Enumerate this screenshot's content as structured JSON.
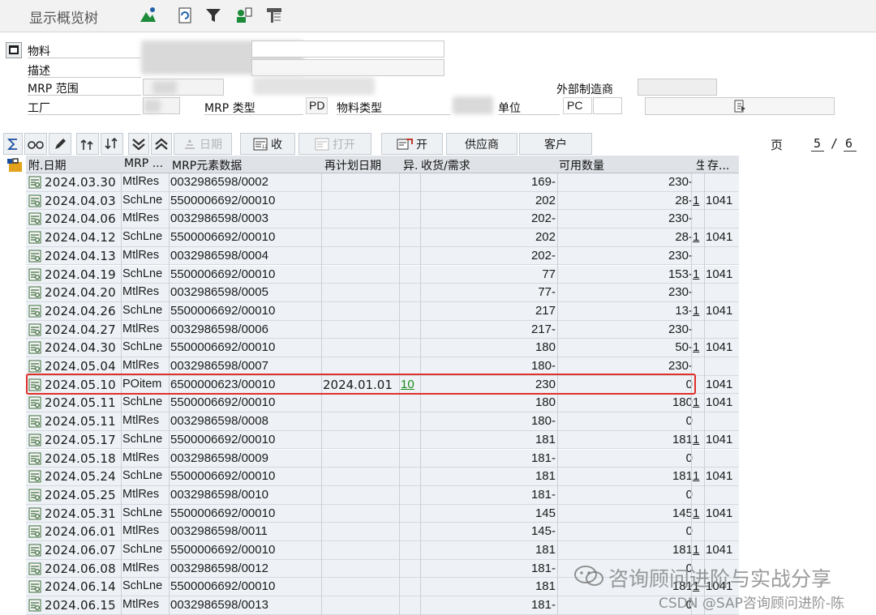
{
  "app": {
    "title": "显示概览树"
  },
  "header": {
    "material_label": "物料",
    "description_label": "描述",
    "mrp_area_label": "MRP 范围",
    "plant_label": "工厂",
    "mrp_type_label": "MRP 类型",
    "mrp_type_value": "PD",
    "material_type_label": "物料类型",
    "unit_label": "单位",
    "unit_value": "PC",
    "external_mfr_label": "外部制造商"
  },
  "toolbar": {
    "date_label": "日期",
    "receipts_label": "收",
    "open_label": "打开",
    "open2_label": "开",
    "vendor_label": "供应商",
    "customer_label": "客户",
    "page_label": "页",
    "page_current": "5",
    "page_sep": "/",
    "page_total": "6"
  },
  "columns": {
    "date": "附.日期",
    "mrp_elem": "MRP ...",
    "mrp_elem_data": "MRP元素数据",
    "reschedule_date": "再计划日期",
    "exception": "异.",
    "rec_req": "收货/需求",
    "available": "可用数量",
    "flag": "生",
    "storage": "存..."
  },
  "rows": [
    {
      "date": "2024.03.30",
      "mrp": "MtlRes",
      "elem": "0032986598/0002",
      "resched": "",
      "exc": "",
      "qty": "169-",
      "avail": "230-",
      "flag": "",
      "store": ""
    },
    {
      "date": "2024.04.03",
      "mrp": "SchLne",
      "elem": "5500006692/00010",
      "resched": "",
      "exc": "",
      "qty": "202",
      "avail": "28-",
      "flag": "1",
      "store": "1041"
    },
    {
      "date": "2024.04.06",
      "mrp": "MtlRes",
      "elem": "0032986598/0003",
      "resched": "",
      "exc": "",
      "qty": "202-",
      "avail": "230-",
      "flag": "",
      "store": ""
    },
    {
      "date": "2024.04.12",
      "mrp": "SchLne",
      "elem": "5500006692/00010",
      "resched": "",
      "exc": "",
      "qty": "202",
      "avail": "28-",
      "flag": "1",
      "store": "1041"
    },
    {
      "date": "2024.04.13",
      "mrp": "MtlRes",
      "elem": "0032986598/0004",
      "resched": "",
      "exc": "",
      "qty": "202-",
      "avail": "230-",
      "flag": "",
      "store": ""
    },
    {
      "date": "2024.04.19",
      "mrp": "SchLne",
      "elem": "5500006692/00010",
      "resched": "",
      "exc": "",
      "qty": "77",
      "avail": "153-",
      "flag": "1",
      "store": "1041"
    },
    {
      "date": "2024.04.20",
      "mrp": "MtlRes",
      "elem": "0032986598/0005",
      "resched": "",
      "exc": "",
      "qty": "77-",
      "avail": "230-",
      "flag": "",
      "store": ""
    },
    {
      "date": "2024.04.26",
      "mrp": "SchLne",
      "elem": "5500006692/00010",
      "resched": "",
      "exc": "",
      "qty": "217",
      "avail": "13-",
      "flag": "1",
      "store": "1041"
    },
    {
      "date": "2024.04.27",
      "mrp": "MtlRes",
      "elem": "0032986598/0006",
      "resched": "",
      "exc": "",
      "qty": "217-",
      "avail": "230-",
      "flag": "",
      "store": ""
    },
    {
      "date": "2024.04.30",
      "mrp": "SchLne",
      "elem": "5500006692/00010",
      "resched": "",
      "exc": "",
      "qty": "180",
      "avail": "50-",
      "flag": "1",
      "store": "1041"
    },
    {
      "date": "2024.05.04",
      "mrp": "MtlRes",
      "elem": "0032986598/0007",
      "resched": "",
      "exc": "",
      "qty": "180-",
      "avail": "230-",
      "flag": "",
      "store": ""
    },
    {
      "date": "2024.05.10",
      "mrp": "POitem",
      "elem": "6500000623/00010",
      "resched": "2024.01.01",
      "exc": "10",
      "qty": "230",
      "avail": "0",
      "flag": "",
      "store": "1041"
    },
    {
      "date": "2024.05.11",
      "mrp": "SchLne",
      "elem": "5500006692/00010",
      "resched": "",
      "exc": "",
      "qty": "180",
      "avail": "180",
      "flag": "1",
      "store": "1041"
    },
    {
      "date": "2024.05.11",
      "mrp": "MtlRes",
      "elem": "0032986598/0008",
      "resched": "",
      "exc": "",
      "qty": "180-",
      "avail": "0",
      "flag": "",
      "store": ""
    },
    {
      "date": "2024.05.17",
      "mrp": "SchLne",
      "elem": "5500006692/00010",
      "resched": "",
      "exc": "",
      "qty": "181",
      "avail": "181",
      "flag": "1",
      "store": "1041"
    },
    {
      "date": "2024.05.18",
      "mrp": "MtlRes",
      "elem": "0032986598/0009",
      "resched": "",
      "exc": "",
      "qty": "181-",
      "avail": "0",
      "flag": "",
      "store": ""
    },
    {
      "date": "2024.05.24",
      "mrp": "SchLne",
      "elem": "5500006692/00010",
      "resched": "",
      "exc": "",
      "qty": "181",
      "avail": "181",
      "flag": "1",
      "store": "1041"
    },
    {
      "date": "2024.05.25",
      "mrp": "MtlRes",
      "elem": "0032986598/0010",
      "resched": "",
      "exc": "",
      "qty": "181-",
      "avail": "0",
      "flag": "",
      "store": ""
    },
    {
      "date": "2024.05.31",
      "mrp": "SchLne",
      "elem": "5500006692/00010",
      "resched": "",
      "exc": "",
      "qty": "145",
      "avail": "145",
      "flag": "1",
      "store": "1041"
    },
    {
      "date": "2024.06.01",
      "mrp": "MtlRes",
      "elem": "0032986598/0011",
      "resched": "",
      "exc": "",
      "qty": "145-",
      "avail": "0",
      "flag": "",
      "store": ""
    },
    {
      "date": "2024.06.07",
      "mrp": "SchLne",
      "elem": "5500006692/00010",
      "resched": "",
      "exc": "",
      "qty": "181",
      "avail": "181",
      "flag": "1",
      "store": "1041"
    },
    {
      "date": "2024.06.08",
      "mrp": "MtlRes",
      "elem": "0032986598/0012",
      "resched": "",
      "exc": "",
      "qty": "181-",
      "avail": "0",
      "flag": "",
      "store": ""
    },
    {
      "date": "2024.06.14",
      "mrp": "SchLne",
      "elem": "5500006692/00010",
      "resched": "",
      "exc": "",
      "qty": "181",
      "avail": "181",
      "flag": "1",
      "store": "1041"
    },
    {
      "date": "2024.06.15",
      "mrp": "MtlRes",
      "elem": "0032986598/0013",
      "resched": "",
      "exc": "",
      "qty": "181-",
      "avail": "0",
      "flag": "",
      "store": ""
    }
  ],
  "watermark": {
    "line1": "咨询顾问进阶与实战分享",
    "line2": "CSDN @SAP咨询顾问进阶-陈"
  },
  "colors": {
    "highlight": "#e0302a",
    "exception_link": "#1b8a1b",
    "row_bg": "#eef2f6",
    "header_bg": "#dfe3e8"
  },
  "icons": [
    "hierarchy-icon",
    "refresh-icon",
    "filter-icon",
    "user-icon",
    "print-layout-icon",
    "collapse-icon",
    "sum-icon",
    "glasses-icon",
    "pencil-icon",
    "tree-expand-icon",
    "chevron-down-double-icon",
    "chevron-up-double-icon",
    "doc-detail-icon",
    "open-icon",
    "launch-icon",
    "row-detail-icon",
    "wechat-icon"
  ]
}
